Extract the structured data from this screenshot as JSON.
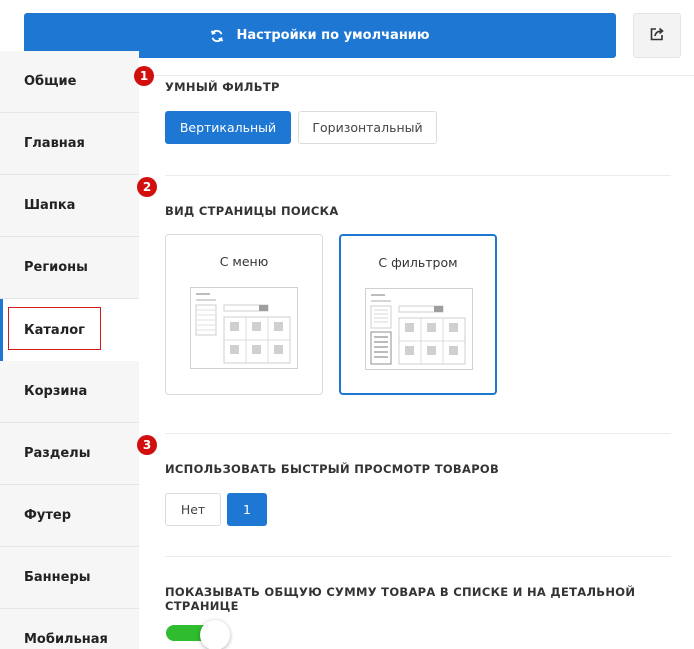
{
  "toolbar": {
    "reset_label": "Настройки по умолчанию",
    "reset_icon": "refresh-icon",
    "share_icon": "share-icon",
    "accent": "#1e77d3"
  },
  "sidebar": {
    "items": [
      {
        "label": "Общие"
      },
      {
        "label": "Главная"
      },
      {
        "label": "Шапка"
      },
      {
        "label": "Регионы"
      },
      {
        "label": "Каталог",
        "active": true
      },
      {
        "label": "Корзина"
      },
      {
        "label": "Разделы"
      },
      {
        "label": "Футер"
      },
      {
        "label": "Баннеры"
      },
      {
        "label": "Мобильная"
      }
    ]
  },
  "markers": [
    "1",
    "2",
    "3"
  ],
  "smart_filter": {
    "title": "УМНЫЙ ФИЛЬТР",
    "options": [
      "Вертикальный",
      "Горизонтальный"
    ],
    "selected": "Вертикальный"
  },
  "search_view": {
    "title": "ВИД СТРАНИЦЫ ПОИСКА",
    "options": [
      "С меню",
      "С фильтром"
    ],
    "selected": "С фильтром"
  },
  "quick_view": {
    "title": "ИСПОЛЬЗОВАТЬ БЫСТРЫЙ ПРОСМОТР ТОВАРОВ",
    "options": [
      "Нет",
      "1"
    ],
    "selected": "1"
  },
  "total_sum": {
    "title": "ПОКАЗЫВАТЬ ОБЩУЮ СУММУ ТОВАРА В СПИСКЕ И НА ДЕТАЛЬНОЙ СТРАНИЦЕ",
    "enabled": true,
    "toggle_color": "#2fbc2f"
  },
  "marker_color": "#d10f0f"
}
